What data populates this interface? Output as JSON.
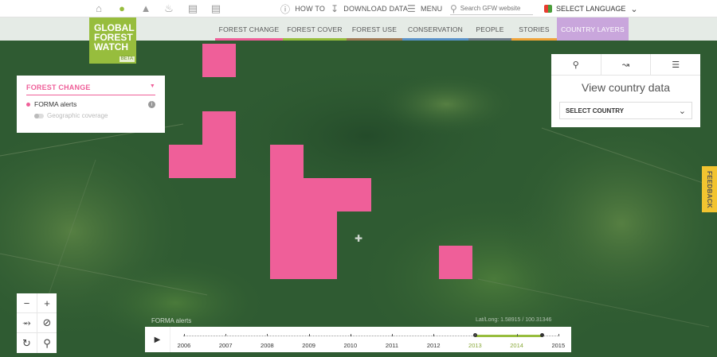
{
  "topbar": {
    "how_to": "HOW TO",
    "download": "DOWNLOAD DATA",
    "menu": "MENU",
    "search_placeholder": "Search GFW website",
    "language": "SELECT LANGUAGE"
  },
  "logo": {
    "line1": "GLOBAL",
    "line2": "FOREST",
    "line3": "WATCH",
    "beta": "BETA"
  },
  "tabs": [
    {
      "label": "FOREST CHANGE",
      "color": "#ef5f99"
    },
    {
      "label": "FOREST COVER",
      "color": "#97bd3d"
    },
    {
      "label": "FOREST USE",
      "color": "#a07b55"
    },
    {
      "label": "CONSERVATION",
      "color": "#5a93c9"
    },
    {
      "label": "PEOPLE",
      "color": "#707d8b"
    },
    {
      "label": "STORIES",
      "color": "#f0a43a"
    },
    {
      "label": "COUNTRY LAYERS",
      "color": "#c9a6dc"
    }
  ],
  "layer_panel": {
    "title": "FOREST CHANGE",
    "layer": "FORMA alerts",
    "sublayer": "Geographic coverage"
  },
  "country_panel": {
    "title": "View country data",
    "select": "SELECT COUNTRY"
  },
  "feedback": "FEEDBACK",
  "timeline": {
    "years": [
      "2006",
      "2007",
      "2008",
      "2009",
      "2010",
      "2011",
      "2012",
      "2013",
      "2014",
      "2015"
    ],
    "selected_start": "2013",
    "selected_end": "2014"
  },
  "map": {
    "layer_label": "FORMA alerts",
    "latlon": "Lat/Long: 1.58915 / 100.31346",
    "alert_color": "#ef5f99"
  }
}
